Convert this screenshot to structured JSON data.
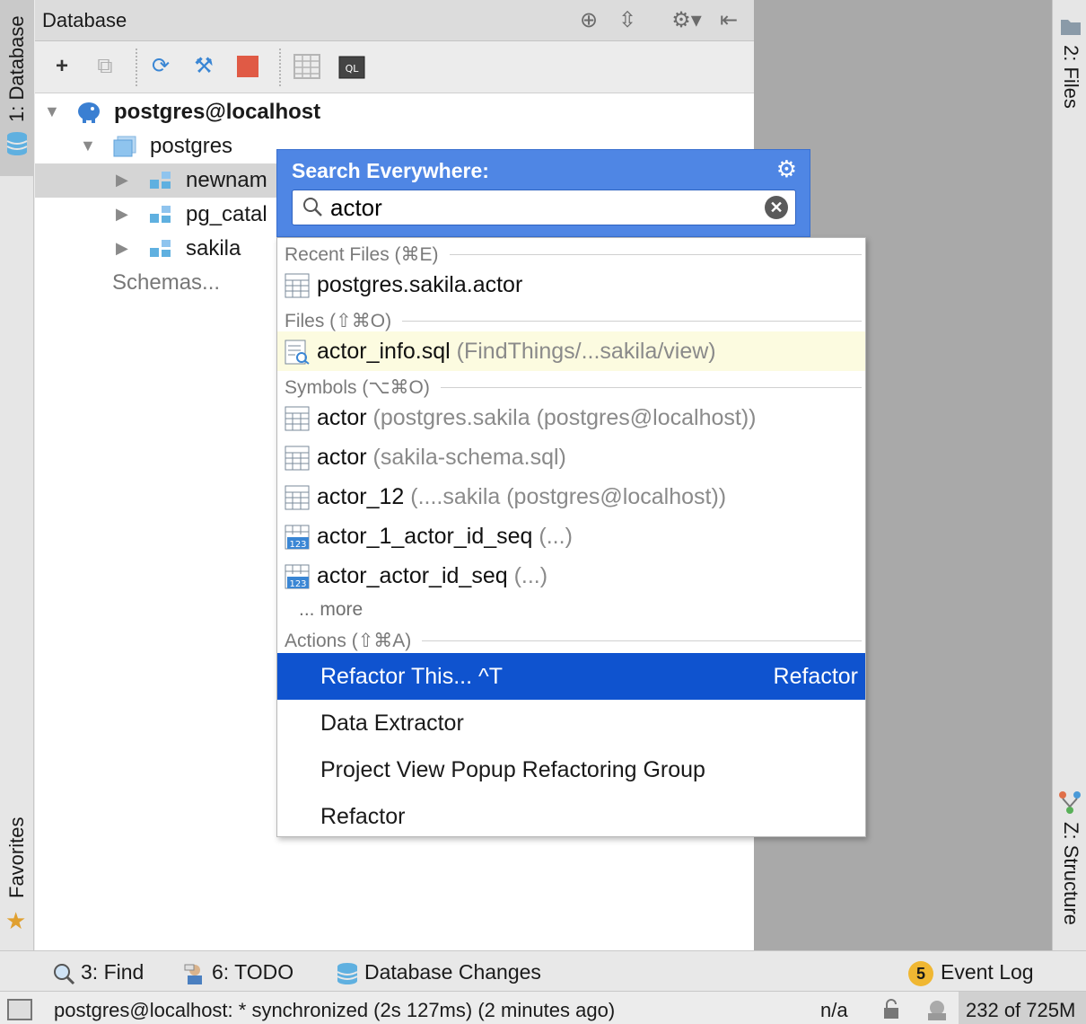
{
  "left_strip": {
    "database_tab": "1: Database",
    "favorites_tab": "Favorites"
  },
  "right_strip": {
    "files_tab": "2: Files",
    "structure_tab": "Z: Structure"
  },
  "db_panel": {
    "title": "Database",
    "tree": [
      {
        "label": "postgres@localhost",
        "bold": true
      },
      {
        "label": "postgres"
      },
      {
        "label": "newnam"
      },
      {
        "label": "pg_catal"
      },
      {
        "label": "sakila"
      },
      {
        "label": "Schemas..."
      }
    ]
  },
  "search": {
    "title": "Search Everywhere:",
    "query": "actor",
    "sections": {
      "recent_files": "Recent Files (⌘E)",
      "files": "Files (⇧⌘O)",
      "symbols": "Symbols (⌥⌘O)",
      "actions": "Actions (⇧⌘A)"
    },
    "recent_files": [
      {
        "name": "postgres.sakila.actor",
        "loc": ""
      }
    ],
    "files": [
      {
        "name": "actor_info.sql",
        "loc": "(FindThings/...sakila/view)"
      }
    ],
    "symbols": [
      {
        "name": "actor",
        "loc": "(postgres.sakila (postgres@localhost))"
      },
      {
        "name": "actor",
        "loc": "(sakila-schema.sql)"
      },
      {
        "name": "actor_12",
        "loc": "(....sakila (postgres@localhost))"
      },
      {
        "name": "actor_1_actor_id_seq",
        "loc": "(...)"
      },
      {
        "name": "actor_actor_id_seq",
        "loc": "(...)"
      }
    ],
    "more": "... more",
    "actions": [
      {
        "label": "Refactor This... ^T",
        "group": "Refactor"
      },
      {
        "label": "Data Extractor",
        "group": ""
      },
      {
        "label": "Project View Popup Refactoring Group",
        "group": ""
      },
      {
        "label": "Refactor",
        "group": ""
      }
    ]
  },
  "bottom_bar": {
    "find": "3: Find",
    "todo": "6: TODO",
    "db_changes": "Database Changes",
    "event_count": "5",
    "event_log": "Event Log"
  },
  "status": {
    "text": "postgres@localhost: * synchronized (2s 127ms) (2 minutes ago)",
    "na": "n/a",
    "memory": "232 of 725M"
  },
  "colors": {
    "accent": "#4f86e4",
    "selection": "#0f53cf",
    "highlight": "#fcfbe0"
  }
}
